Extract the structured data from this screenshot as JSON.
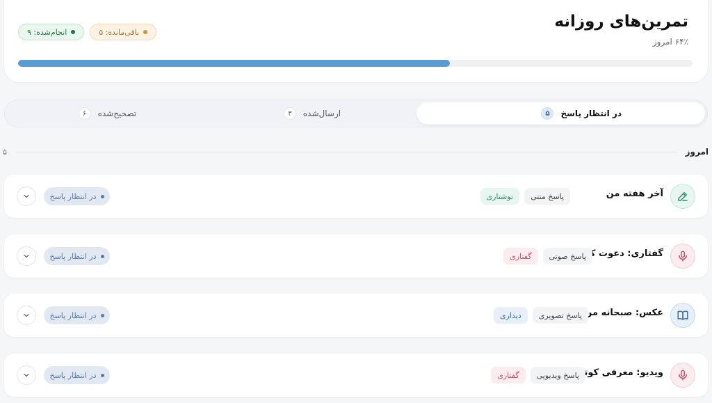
{
  "header": {
    "title": "تمرین‌های روزانه",
    "subtitle": "۶۴٪ امروز",
    "progress": 0.64,
    "badge_done": "انجام‌شده: ۹",
    "badge_left": "باقی‌مانده: ۵",
    "colors": {
      "progress": "#5b9bd5",
      "done": "#217a3c",
      "left": "#d1923a"
    }
  },
  "tabs": [
    {
      "label": "در انتظار پاسخ",
      "count": "۵",
      "active": true
    },
    {
      "label": "ارسال‌شده",
      "count": "۳",
      "active": false
    },
    {
      "label": "تصحیح‌شده",
      "count": "۶",
      "active": false
    }
  ],
  "section": {
    "label": "امروز",
    "count": "۵"
  },
  "items": [
    {
      "title": "آخر هفته من",
      "category": "نوشتاری",
      "type": "پاسخ متنی",
      "status": "در انتظار پاسخ",
      "icon": "pencil-icon",
      "color": "green"
    },
    {
      "title": "گفتاری: دعوت کردن",
      "category": "گفتاری",
      "type": "پاسخ صوتی",
      "status": "در انتظار پاسخ",
      "icon": "microphone-icon",
      "color": "pink"
    },
    {
      "title": "عکس: صبحانه من",
      "category": "دیداری",
      "type": "پاسخ تصویری",
      "status": "در انتظار پاسخ",
      "icon": "book-icon",
      "color": "blue"
    },
    {
      "title": "ویدیو: معرفی کوتاه",
      "category": "گفتاری",
      "type": "پاسخ ویدیویی",
      "status": "در انتظار پاسخ",
      "icon": "microphone-icon",
      "color": "pink"
    }
  ]
}
